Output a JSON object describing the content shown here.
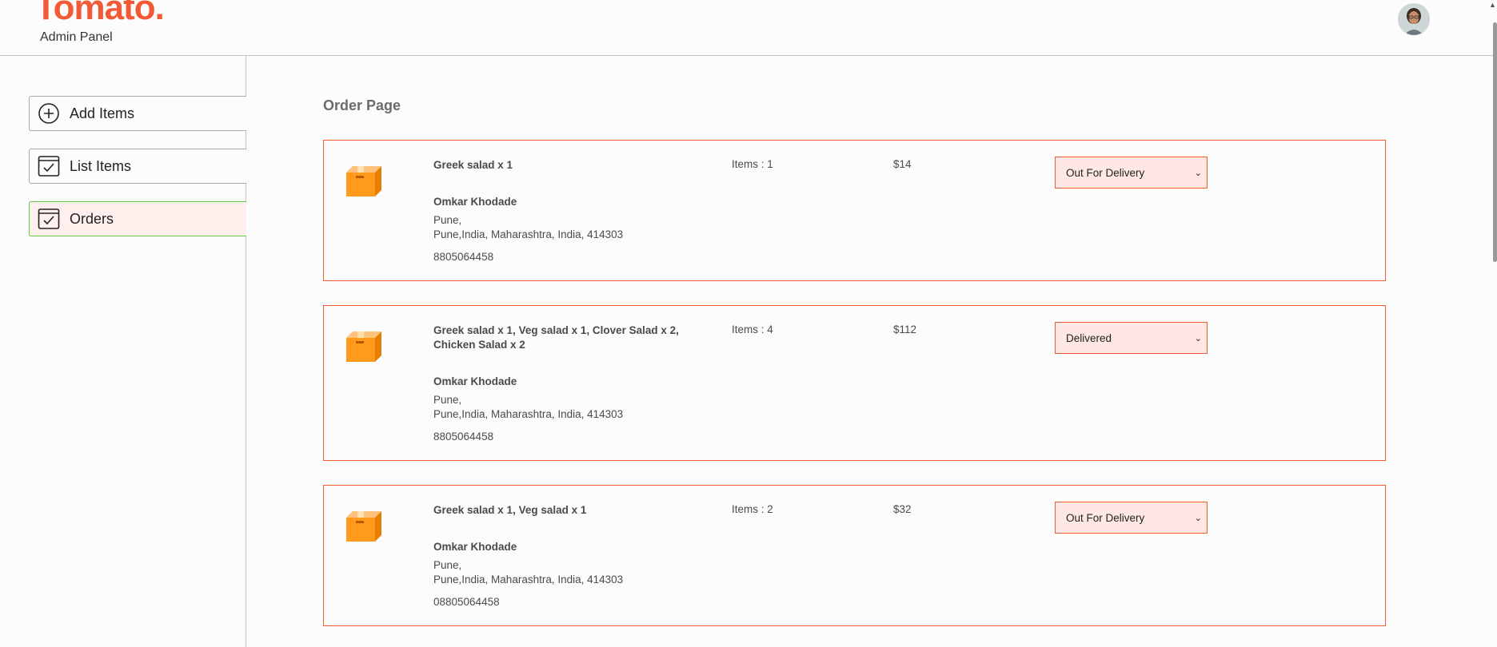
{
  "header": {
    "logo": "Tomato.",
    "subtitle": "Admin Panel",
    "profile_icon": "avatar-image"
  },
  "sidebar": {
    "items": [
      {
        "label": "Add Items",
        "icon": "plus-circle-icon",
        "active": false
      },
      {
        "label": "List Items",
        "icon": "checklist-icon",
        "active": false
      },
      {
        "label": "Orders",
        "icon": "checklist-icon",
        "active": true
      }
    ]
  },
  "main": {
    "title": "Order Page",
    "orders": [
      {
        "items_text": "Greek salad x 1",
        "name": "Omkar Khodade",
        "address_line1": "Pune,",
        "address_line2": "Pune,India, Maharashtra, India, 414303",
        "phone": "8805064458",
        "count": "Items : 1",
        "amount": "$14",
        "status": "Out For Delivery"
      },
      {
        "items_text": "Greek salad x 1, Veg salad x 1, Clover Salad x 2, Chicken Salad x 2",
        "name": "Omkar Khodade",
        "address_line1": "Pune,",
        "address_line2": "Pune,India, Maharashtra, India, 414303",
        "phone": "8805064458",
        "count": "Items : 4",
        "amount": "$112",
        "status": "Delivered"
      },
      {
        "items_text": "Greek salad x 1, Veg salad x 1",
        "name": "Omkar Khodade",
        "address_line1": "Pune,",
        "address_line2": "Pune,India, Maharashtra, India, 414303",
        "phone": "08805064458",
        "count": "Items : 2",
        "amount": "$32",
        "status": "Out For Delivery"
      }
    ]
  },
  "colors": {
    "brand": "#f25a35",
    "active_border": "#5fcb4a",
    "active_bg": "#fff0ee",
    "parcel": "#ff9a1a"
  }
}
